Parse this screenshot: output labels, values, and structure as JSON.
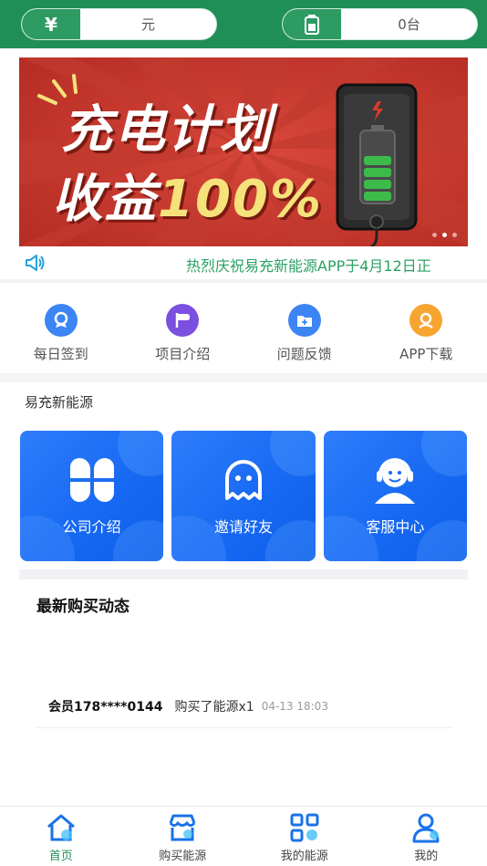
{
  "header": {
    "balance_icon": "yen-icon",
    "balance_value": "元",
    "devices_icon": "battery-icon",
    "devices_value": "0台"
  },
  "banner": {
    "line1": "充电计划",
    "line2_prefix": "收益",
    "line2_highlight": "100%",
    "bg_color": "#c83228",
    "highlight_color": "#f5e27a",
    "slides": 3,
    "active_slide": 2
  },
  "notice": {
    "icon": "speaker-icon",
    "text": "热烈庆祝易充新能源APP于4月12日正"
  },
  "quick": [
    {
      "label": "每日签到",
      "icon": "checkin-icon",
      "color": "#3d84f5"
    },
    {
      "label": "项目介绍",
      "icon": "flag-icon",
      "color": "#7b4fe0"
    },
    {
      "label": "问题反馈",
      "icon": "folder-plus-icon",
      "color": "#3d84f5"
    },
    {
      "label": "APP下载",
      "icon": "download-icon",
      "color": "#f7a531"
    }
  ],
  "section": {
    "title": "易充新能源"
  },
  "cards": [
    {
      "label": "公司介绍",
      "icon": "clover-icon"
    },
    {
      "label": "邀请好友",
      "icon": "ghost-icon"
    },
    {
      "label": "客服中心",
      "icon": "support-agent-icon"
    }
  ],
  "feed": {
    "title": "最新购买动态",
    "items": [
      {
        "member": "会员178****0144",
        "action": "购买了能源x1",
        "time": "04-13 18:03"
      }
    ]
  },
  "tabbar": [
    {
      "label": "首页",
      "icon": "home-icon",
      "active": true
    },
    {
      "label": "购买能源",
      "icon": "store-icon",
      "active": false
    },
    {
      "label": "我的能源",
      "icon": "grid-icon",
      "active": false
    },
    {
      "label": "我的",
      "icon": "user-icon",
      "active": false
    }
  ],
  "colors": {
    "brand_green": "#1f8f57",
    "card_blue": "#1668f2",
    "notice_green": "#2aa063"
  }
}
